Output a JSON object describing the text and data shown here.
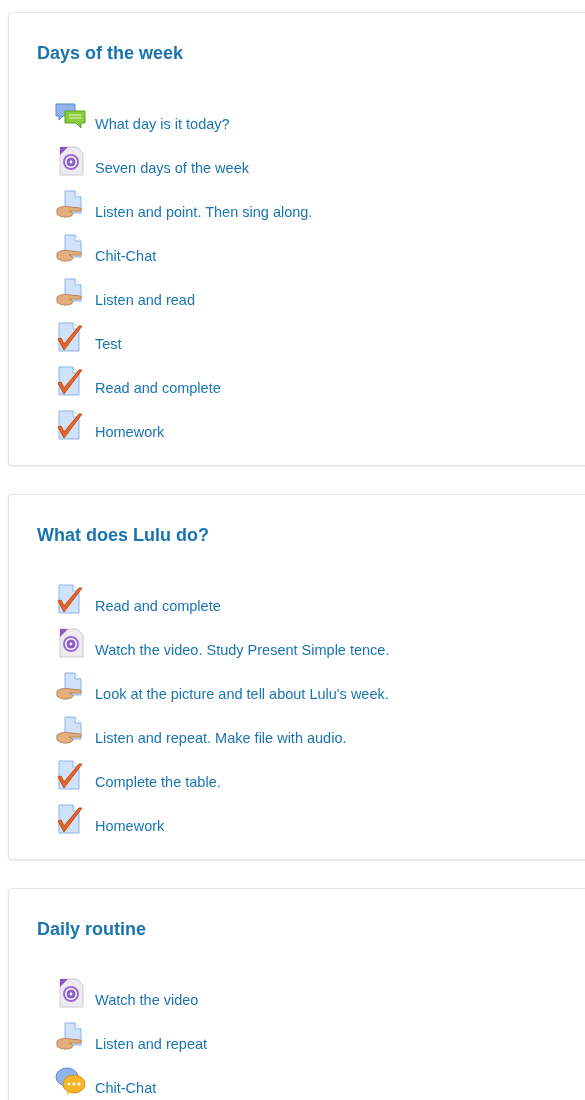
{
  "sections": [
    {
      "title": "Days of the week",
      "items": [
        {
          "kind": "forum",
          "label": "What day is it today?"
        },
        {
          "kind": "video",
          "label": "Seven days of the week"
        },
        {
          "kind": "assignment",
          "label": "Listen and point. Then sing along."
        },
        {
          "kind": "assignment",
          "label": "Chit-Chat"
        },
        {
          "kind": "assignment",
          "label": "Listen and read"
        },
        {
          "kind": "quiz",
          "label": "Test"
        },
        {
          "kind": "quiz",
          "label": "Read and complete"
        },
        {
          "kind": "quiz",
          "label": "Homework"
        }
      ]
    },
    {
      "title": "What does Lulu do?",
      "items": [
        {
          "kind": "quiz",
          "label": "Read and complete"
        },
        {
          "kind": "video",
          "label": "Watch the video. Study Present Simple tence."
        },
        {
          "kind": "assignment",
          "label": "Look at the picture and tell about Lulu's week."
        },
        {
          "kind": "assignment",
          "label": "Listen and repeat. Make file with audio."
        },
        {
          "kind": "quiz",
          "label": "Complete the table."
        },
        {
          "kind": "quiz",
          "label": "Homework"
        }
      ]
    },
    {
      "title": "Daily routine",
      "items": [
        {
          "kind": "video",
          "label": "Watch the video"
        },
        {
          "kind": "assignment",
          "label": "Listen and repeat"
        },
        {
          "kind": "chat",
          "label": "Chit-Chat"
        }
      ]
    }
  ]
}
